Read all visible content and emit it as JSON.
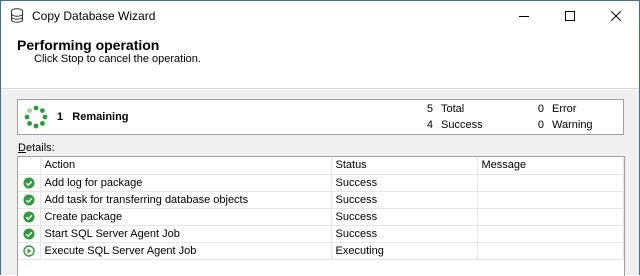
{
  "window": {
    "title": "Copy Database Wizard"
  },
  "header": {
    "title": "Performing operation",
    "subtitle": "Click Stop to cancel the operation."
  },
  "summary": {
    "remaining_count": "1",
    "remaining_label": "Remaining",
    "total_count": "5",
    "total_label": "Total",
    "success_count": "4",
    "success_label": "Success",
    "error_count": "0",
    "error_label": "Error",
    "warning_count": "0",
    "warning_label": "Warning"
  },
  "details": {
    "label_underlined": "D",
    "label_rest": "etails:",
    "columns": {
      "action": "Action",
      "status": "Status",
      "message": "Message"
    },
    "rows": [
      {
        "icon": "success-check-icon",
        "action": "Add log for package",
        "status": "Success",
        "message": ""
      },
      {
        "icon": "success-check-icon",
        "action": "Add task for transferring database objects",
        "status": "Success",
        "message": ""
      },
      {
        "icon": "success-check-icon",
        "action": "Create package",
        "status": "Success",
        "message": ""
      },
      {
        "icon": "success-check-icon",
        "action": "Start SQL Server Agent Job",
        "status": "Success",
        "message": ""
      },
      {
        "icon": "executing-arrow-icon",
        "action": "Execute SQL Server Agent Job",
        "status": "Executing",
        "message": ""
      }
    ]
  },
  "colors": {
    "success_green": "#2f9a3c",
    "window_border": "#3a6ea5",
    "panel_bg": "#f0f0f0"
  }
}
